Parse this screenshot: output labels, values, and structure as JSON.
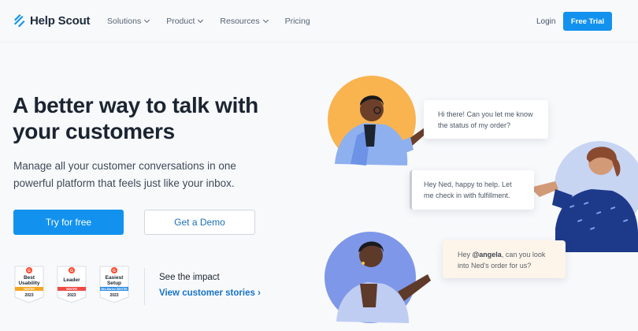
{
  "brand": {
    "name": "Help Scout",
    "logo_icon": "helpscout-logo-icon",
    "accent": "#1292ee"
  },
  "nav": {
    "items": [
      {
        "label": "Solutions",
        "has_menu": true
      },
      {
        "label": "Product",
        "has_menu": true
      },
      {
        "label": "Resources",
        "has_menu": true
      },
      {
        "label": "Pricing",
        "has_menu": false
      }
    ],
    "login": "Login",
    "trial": "Free Trial"
  },
  "hero": {
    "headline": "A better way to talk with your customers",
    "subtext": "Manage all your customer conversations in one powerful platform that feels just like your inbox.",
    "primary_cta": "Try for free",
    "secondary_cta": "Get a Demo"
  },
  "badges": [
    {
      "title": "Best Usability",
      "season": "WINTER",
      "year": "2023",
      "ribbon": "#f5a623"
    },
    {
      "title": "Leader",
      "season": "WINTER",
      "year": "2023",
      "ribbon": "#ef4b47"
    },
    {
      "title": "Easiest Setup",
      "season": "Mid-Market WINTER",
      "year": "2023",
      "ribbon": "#2d8ee6"
    }
  ],
  "impact": {
    "label": "See the impact",
    "link": "View customer stories ›"
  },
  "chat": {
    "bubble1": "Hi there! Can you let me know the status of my order?",
    "bubble2": "Hey Ned, happy to help. Let me check in with fulfillment.",
    "bubble3_mention": "@angela",
    "bubble3_pre": "Hey ",
    "bubble3_post": ", can you look into Ned's order for us?"
  },
  "colors": {
    "orange_circle": "#f9b450",
    "blue_circle": "#c7d5f3",
    "periwinkle_circle": "#7e97e8",
    "button_blue": "#1292ee"
  }
}
